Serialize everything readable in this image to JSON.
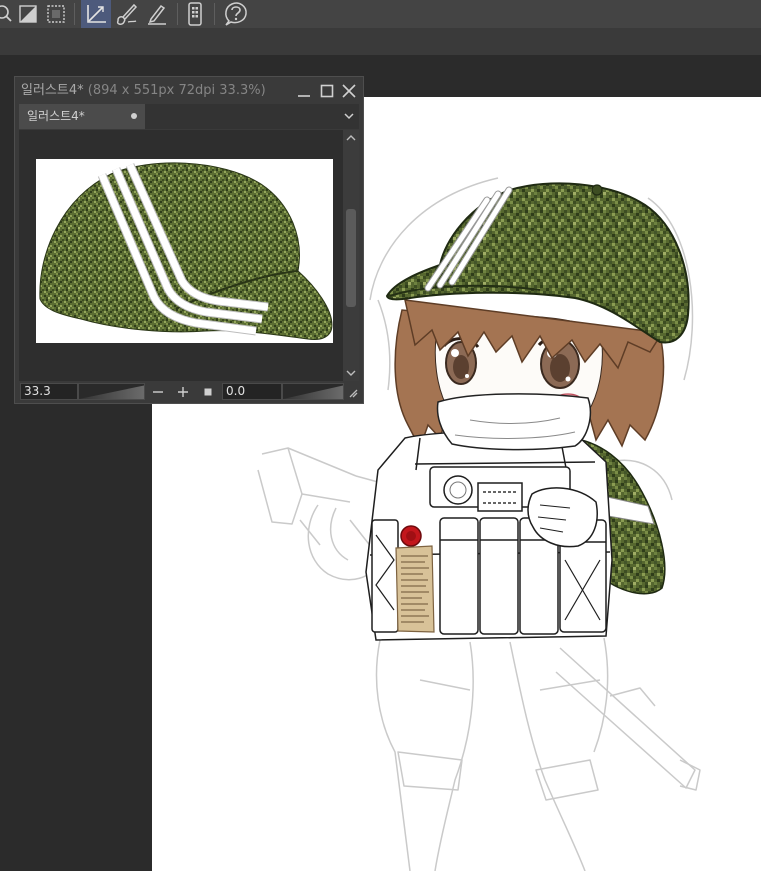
{
  "app": {
    "workspace_color": "#2b2b2b",
    "canvas_color": "#ffffff"
  },
  "toolbar": {
    "accent": "#4d5a7c",
    "tools": [
      {
        "icon": "zoom-icon"
      },
      {
        "icon": "gradient-icon"
      },
      {
        "icon": "selection-icon"
      },
      {
        "icon": "straight-line-icon",
        "selected": true
      },
      {
        "icon": "brush-icon"
      },
      {
        "icon": "pen-icon"
      },
      {
        "icon": "smartphone-icon"
      },
      {
        "icon": "help-icon"
      }
    ]
  },
  "subview": {
    "title_name": "일러스트4*",
    "title_info": "(894 x 551px 72dpi 33.3%)",
    "tab_label": "일러스트4*",
    "zoom_value": "33.3",
    "rotation_value": "0.0",
    "icons": {
      "minimize": "minimize-icon",
      "maximize": "maximize-icon",
      "close": "close-icon",
      "menu": "chevron-down-icon",
      "zoom_out": "zoom-out-icon",
      "zoom_in": "zoom-in-icon",
      "fit": "fit-to-view-icon"
    }
  }
}
